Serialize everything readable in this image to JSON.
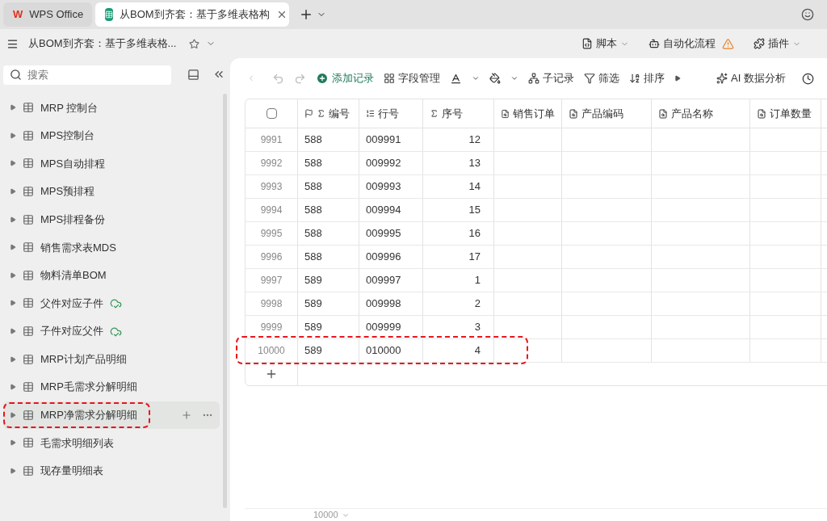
{
  "tabs": [
    {
      "label": "WPS Office",
      "kind": "home",
      "logo": "W",
      "selected": false
    },
    {
      "label": "从BOM到齐套：基于多维表格构",
      "kind": "doc",
      "selected": true
    }
  ],
  "doc_title": "从BOM到齐套：基于多维表格...",
  "top_actions": [
    {
      "label": "脚本",
      "kind": "script",
      "warning": false
    },
    {
      "label": "自动化流程",
      "kind": "robot",
      "warning": true
    },
    {
      "label": "插件",
      "kind": "plugin",
      "warning": false
    }
  ],
  "search": {
    "placeholder": "搜索"
  },
  "sidebar": {
    "items": [
      {
        "label": "MRP 控制台",
        "synced": false,
        "selected": false
      },
      {
        "label": "MPS控制台",
        "synced": false,
        "selected": false
      },
      {
        "label": "MPS自动排程",
        "synced": false,
        "selected": false
      },
      {
        "label": "MPS预排程",
        "synced": false,
        "selected": false
      },
      {
        "label": "MPS排程备份",
        "synced": false,
        "selected": false
      },
      {
        "label": "销售需求表MDS",
        "synced": false,
        "selected": false
      },
      {
        "label": "物料清单BOM",
        "synced": false,
        "selected": false
      },
      {
        "label": "父件对应子件",
        "synced": true,
        "selected": false
      },
      {
        "label": "子件对应父件",
        "synced": true,
        "selected": false
      },
      {
        "label": "MRP计划产品明细",
        "synced": false,
        "selected": false
      },
      {
        "label": "MRP毛需求分解明细",
        "synced": false,
        "selected": false
      },
      {
        "label": "MRP净需求分解明细",
        "synced": false,
        "selected": true,
        "highlighted": true
      },
      {
        "label": "毛需求明细列表",
        "synced": false,
        "selected": false
      },
      {
        "label": "现存量明细表",
        "synced": false,
        "selected": false
      }
    ]
  },
  "toolbar": [
    {
      "label": "添加记录",
      "kind": "add"
    },
    {
      "label": "字段管理",
      "kind": "fields"
    },
    {
      "label": "子记录",
      "kind": "sub"
    },
    {
      "label": "筛选",
      "kind": "filter"
    },
    {
      "label": "排序",
      "kind": "sort"
    },
    {
      "label": "AI 数据分析",
      "kind": "ai"
    }
  ],
  "table": {
    "header_checkbox": {
      "checked": false
    },
    "columns": [
      {
        "label": "编号",
        "kind": "flag"
      },
      {
        "label": "行号",
        "kind": "auto"
      },
      {
        "label": "序号",
        "kind": "sum"
      },
      {
        "label": "销售订单",
        "kind": "lookup"
      },
      {
        "label": "产品编码",
        "kind": "lookup"
      },
      {
        "label": "产品名称",
        "kind": "lookup"
      },
      {
        "label": "订单数量",
        "kind": "lookup"
      }
    ],
    "rows": [
      {
        "index": "9991",
        "cells": [
          "588",
          "009991",
          "12"
        ]
      },
      {
        "index": "9992",
        "cells": [
          "588",
          "009992",
          "13"
        ]
      },
      {
        "index": "9993",
        "cells": [
          "588",
          "009993",
          "14"
        ]
      },
      {
        "index": "9994",
        "cells": [
          "588",
          "009994",
          "15"
        ]
      },
      {
        "index": "9995",
        "cells": [
          "588",
          "009995",
          "16"
        ]
      },
      {
        "index": "9996",
        "cells": [
          "588",
          "009996",
          "17"
        ]
      },
      {
        "index": "9997",
        "cells": [
          "589",
          "009997",
          "1"
        ]
      },
      {
        "index": "9998",
        "cells": [
          "589",
          "009998",
          "2"
        ]
      },
      {
        "index": "9999",
        "cells": [
          "589",
          "009999",
          "3"
        ]
      },
      {
        "index": "10000",
        "cells": [
          "589",
          "010000",
          "4"
        ],
        "highlighted": true
      }
    ]
  },
  "footer": {
    "count": "10000"
  }
}
